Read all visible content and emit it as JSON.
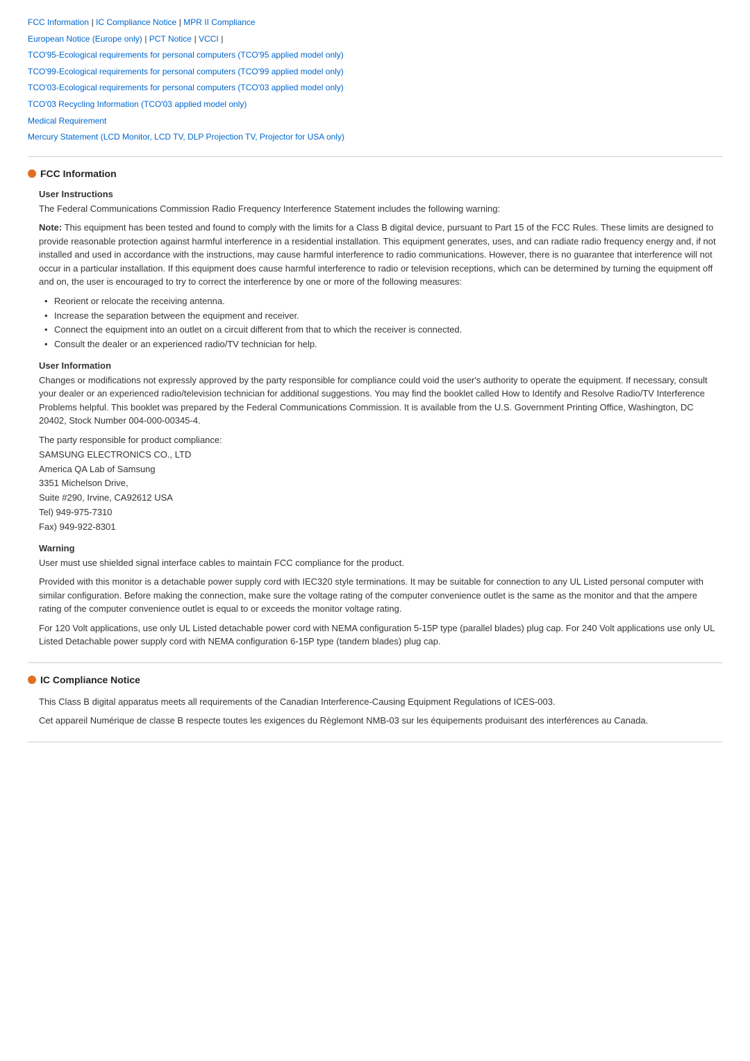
{
  "nav": {
    "links": [
      {
        "label": "FCC Information",
        "id": "fcc"
      },
      {
        "label": "IC Compliance Notice",
        "id": "ic"
      },
      {
        "label": "MPR II Compliance",
        "id": "mpr"
      },
      {
        "label": "European Notice (Europe only)",
        "id": "eu"
      },
      {
        "label": "PCT Notice",
        "id": "pct"
      },
      {
        "label": "VCCI",
        "id": "vcci"
      },
      {
        "label": "TCO'95-Ecological requirements for personal computers (TCO'95 applied model only)",
        "id": "tco95"
      },
      {
        "label": "TCO'99-Ecological requirements for personal computers (TCO'99 applied model only)",
        "id": "tco99"
      },
      {
        "label": "TCO'03-Ecological requirements for personal computers (TCO'03 applied model only)",
        "id": "tco03"
      },
      {
        "label": "TCO'03 Recycling Information (TCO'03 applied model only)",
        "id": "tco03r"
      },
      {
        "label": "Medical Requirement",
        "id": "med"
      },
      {
        "label": "Mercury Statement (LCD Monitor, LCD TV, DLP Projection TV, Projector for USA only)",
        "id": "mercury"
      }
    ]
  },
  "fcc_section": {
    "title": "FCC Information",
    "user_instructions": {
      "heading": "User Instructions",
      "intro": "The Federal Communications Commission Radio Frequency Interference Statement includes the following warning:",
      "note_bold": "Note:",
      "note_text": " This equipment has been tested and found to comply with the limits for a Class B digital device, pursuant to Part 15 of the FCC Rules. These limits are designed to provide reasonable protection against harmful interference in a residential installation. This equipment generates, uses, and can radiate radio frequency energy and, if not installed and used in accordance with the instructions, may cause harmful interference to radio communications. However, there is no guarantee that interference will not occur in a particular installation. If this equipment does cause harmful interference to radio or television receptions, which can be determined by turning the equipment off and on, the user is encouraged to try to correct the interference by one or more of the following measures:",
      "bullets": [
        "Reorient or relocate the receiving antenna.",
        "Increase the separation between the equipment and receiver.",
        "Connect the equipment into an outlet on a circuit different from that to which the receiver is connected.",
        "Consult the dealer or an experienced radio/TV technician for help."
      ]
    },
    "user_information": {
      "heading": "User Information",
      "para1": "Changes or modifications not expressly approved by the party responsible for compliance could void the user's authority to operate the equipment. If necessary, consult your dealer or an experienced radio/television technician for additional suggestions. You may find the booklet called How to Identify and Resolve Radio/TV Interference Problems helpful. This booklet was prepared by the Federal Communications Commission. It is available from the U.S. Government Printing Office, Washington, DC 20402, Stock Number 004-000-00345-4.",
      "para2": "The party responsible for product compliance:",
      "address_lines": [
        "SAMSUNG ELECTRONICS CO., LTD",
        "America QA Lab of Samsung",
        "3351 Michelson Drive,",
        "Suite #290, Irvine, CA92612 USA",
        "Tel) 949-975-7310",
        "Fax) 949-922-8301"
      ]
    },
    "warning": {
      "heading": "Warning",
      "para1": "User must use shielded signal interface cables to maintain FCC compliance for the product.",
      "para2": "Provided with this monitor is a detachable power supply cord with IEC320 style terminations. It may be suitable for connection to any UL Listed personal computer with similar configuration. Before making the connection, make sure the voltage rating of the computer convenience outlet is the same as the monitor and that the ampere rating of the computer convenience outlet is equal to or exceeds the monitor voltage rating.",
      "para3": "For 120 Volt applications, use only UL Listed detachable power cord with NEMA configuration 5-15P type (parallel blades) plug cap. For 240 Volt applications use only UL Listed Detachable power supply cord with NEMA configuration 6-15P type (tandem blades) plug cap."
    }
  },
  "ic_section": {
    "title": "IC Compliance Notice",
    "para1": "This Class B digital apparatus meets all requirements of the Canadian Interference-Causing Equipment Regulations of ICES-003.",
    "para2": "Cet appareil Numérique de classe B respecte toutes les exigences du Règlemont NMB-03 sur les équipements produisant des interférences au Canada."
  }
}
